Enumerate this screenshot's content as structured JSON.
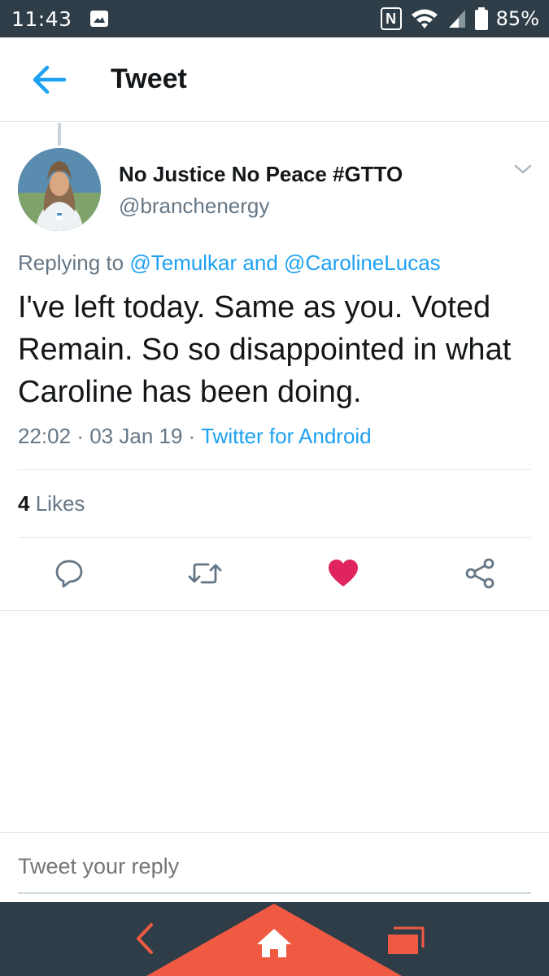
{
  "status_bar": {
    "time": "11:43",
    "battery": "85%",
    "icons": [
      "image-icon",
      "nfc-icon",
      "wifi-icon",
      "signal-icon",
      "battery-icon"
    ]
  },
  "header": {
    "title": "Tweet",
    "back_icon": "arrow-left-icon"
  },
  "tweet": {
    "author_name": "No Justice No Peace #GTTO",
    "author_handle": "@branchenergy",
    "replying_prefix": "Replying to",
    "replying_user_1": "@Temulkar",
    "replying_and": "and",
    "replying_user_2": "@CarolineLucas",
    "text": "I've left today. Same as you. Voted Remain. So so disappointed in what Caroline has been doing.",
    "time": "22:02",
    "date": "03 Jan 19",
    "separator": "·",
    "source": "Twitter for Android",
    "likes_count": "4",
    "likes_label": "Likes",
    "liked": true
  },
  "actions": [
    "reply-icon",
    "retweet-icon",
    "heart-icon",
    "share-icon"
  ],
  "reply": {
    "placeholder": "Tweet your reply"
  },
  "nav_bar": {
    "buttons": [
      "back-icon",
      "home-icon",
      "recents-icon"
    ]
  },
  "colors": {
    "accent": "#1da1f2",
    "like": "#e0245e",
    "status_bar": "#2e3d47",
    "nav_home": "#f05a42",
    "text_secondary": "#657786"
  }
}
